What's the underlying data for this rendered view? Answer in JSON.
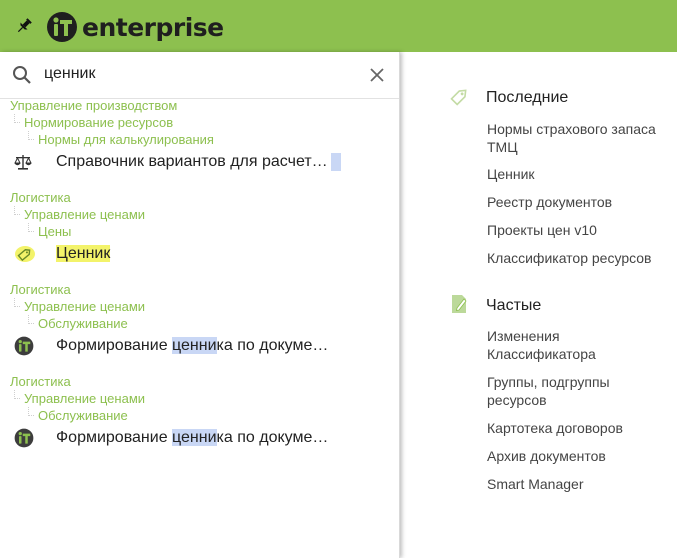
{
  "header": {
    "logo_text": "enterprise",
    "pin_icon": "pin-icon",
    "brand_color": "#8dc04f"
  },
  "search": {
    "value": "ценник",
    "placeholder": "",
    "search_icon": "search-icon",
    "clear_icon": "close-icon"
  },
  "results": [
    {
      "path": [
        "Управление производством",
        "Нормирование ресурсов",
        "Нормы для калькулирования"
      ],
      "icon": "scales-icon",
      "label_before": "Справочник вариантов для расчет…",
      "label_highlight": "",
      "label_after": ""
    },
    {
      "path": [
        "Логистика",
        "Управление ценами",
        "Цены"
      ],
      "icon": "price-tag-icon",
      "label_before": "",
      "label_highlight": "Ценник",
      "label_after": ""
    },
    {
      "path": [
        "Логистика",
        "Управление ценами",
        "Обслуживание"
      ],
      "icon": "it-logo-icon",
      "label_before": "Формирование ",
      "label_highlight": "ценни",
      "label_after": "ка по докуме…"
    },
    {
      "path": [
        "Логистика",
        "Управление ценами",
        "Обслуживание"
      ],
      "icon": "it-logo-icon",
      "label_before": "Формирование ",
      "label_highlight": "ценни",
      "label_after": "ка по докуме…"
    }
  ],
  "recent": {
    "title": "Последние",
    "icon": "price-tag-icon",
    "items": [
      "Нормы страхового запаса ТМЦ",
      "Ценник",
      "Реестр документов",
      "Проекты цен v10",
      "Классификатор ресурсов"
    ]
  },
  "frequent": {
    "title": "Частые",
    "icon": "edit-document-icon",
    "items": [
      "Изменения Классификатора",
      "Группы, подгруппы ресурсов",
      "Картотека договоров",
      "Архив документов",
      "Smart Manager"
    ]
  }
}
